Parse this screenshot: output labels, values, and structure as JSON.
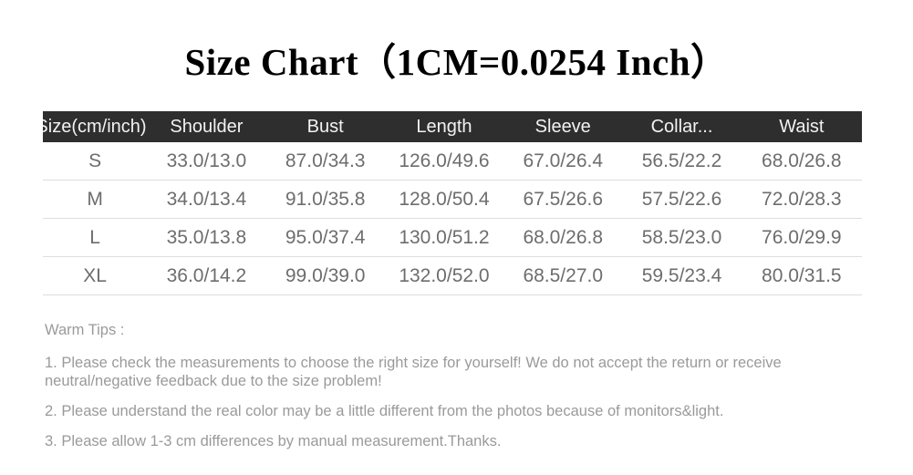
{
  "title": "Size Chart（1CM=0.0254 Inch）",
  "table": {
    "headers": [
      "Size(cm/inch)",
      "Shoulder",
      "Bust",
      "Length",
      "Sleeve",
      "Collar...",
      "Waist"
    ],
    "rows": [
      {
        "size": "S",
        "shoulder": "33.0/13.0",
        "bust": "87.0/34.3",
        "length": "126.0/49.6",
        "sleeve": "67.0/26.4",
        "collar": "56.5/22.2",
        "waist": "68.0/26.8"
      },
      {
        "size": "M",
        "shoulder": "34.0/13.4",
        "bust": "91.0/35.8",
        "length": "128.0/50.4",
        "sleeve": "67.5/26.6",
        "collar": "57.5/22.6",
        "waist": "72.0/28.3"
      },
      {
        "size": "L",
        "shoulder": "35.0/13.8",
        "bust": "95.0/37.4",
        "length": "130.0/51.2",
        "sleeve": "68.0/26.8",
        "collar": "58.5/23.0",
        "waist": "76.0/29.9"
      },
      {
        "size": "XL",
        "shoulder": "36.0/14.2",
        "bust": "99.0/39.0",
        "length": "132.0/52.0",
        "sleeve": "68.5/27.0",
        "collar": "59.5/23.4",
        "waist": "80.0/31.5"
      }
    ]
  },
  "tips": {
    "heading": "Warm Tips :",
    "items": [
      "1. Please check the measurements to choose the right size for yourself! We do not accept the return or receive neutral/negative feedback due to the size problem!",
      "2. Please understand the real color may be a little different from the photos because of monitors&light.",
      "3. Please allow 1-3 cm differences by manual measurement.Thanks."
    ]
  },
  "colors": {
    "header_bg": "#2e2e2e",
    "header_text": "#f2f2f2",
    "cell_text": "#6d6d6d",
    "tips_text": "#9a9a9a",
    "row_divider": "#dddddd",
    "title_text": "#000000",
    "page_bg": "#ffffff"
  },
  "chart_data": {
    "type": "table",
    "title": "Size Chart（1CM=0.0254 Inch）",
    "columns": [
      "Size(cm/inch)",
      "Shoulder",
      "Bust",
      "Length",
      "Sleeve",
      "Collar...",
      "Waist"
    ],
    "rows": [
      [
        "S",
        "33.0/13.0",
        "87.0/34.3",
        "126.0/49.6",
        "67.0/26.4",
        "56.5/22.2",
        "68.0/26.8"
      ],
      [
        "M",
        "34.0/13.4",
        "91.0/35.8",
        "128.0/50.4",
        "67.5/26.6",
        "57.5/22.6",
        "72.0/28.3"
      ],
      [
        "L",
        "35.0/13.8",
        "95.0/37.4",
        "130.0/51.2",
        "68.0/26.8",
        "58.5/23.0",
        "76.0/29.9"
      ],
      [
        "XL",
        "36.0/14.2",
        "99.0/39.0",
        "132.0/52.0",
        "68.5/27.0",
        "59.5/23.4",
        "80.0/31.5"
      ]
    ],
    "units": "values shown as centimeters/inches",
    "conversion_note": "1CM=0.0254 Inch"
  }
}
